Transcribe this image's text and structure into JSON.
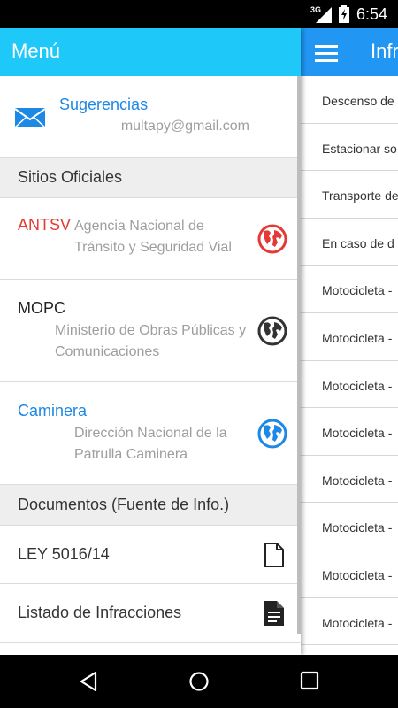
{
  "status_bar": {
    "network": "3G",
    "time": "6:54"
  },
  "background_screen": {
    "title": "Infr",
    "rows": [
      "Descenso de",
      "Estacionar so",
      "Transporte de",
      "En caso de d",
      "Motocicleta -",
      "Motocicleta -",
      "Motocicleta -",
      "Motocicleta -",
      "Motocicleta -",
      "Motocicleta -",
      "Motocicleta -",
      "Motocicleta -"
    ]
  },
  "drawer": {
    "title": "Menú",
    "suggestions": {
      "label": "Sugerencias",
      "email": "multapy@gmail.com",
      "icon": "mail-icon"
    },
    "sites_header": "Sitios Oficiales",
    "sites": [
      {
        "name": "ANTSV",
        "desc": "Agencia Nacional de Tránsito y Seguridad Vial",
        "color": "#e53935",
        "icon_color": "#e53935"
      },
      {
        "name": "MOPC",
        "desc": "Ministerio de Obras Públicas y Comunicaciones",
        "color": "#222222",
        "icon_color": "#333333"
      },
      {
        "name": "Caminera",
        "desc": "Dirección Nacional de la Patrulla Caminera",
        "color": "#1e88e5",
        "icon_color": "#1e88e5"
      }
    ],
    "documents_header": "Documentos (Fuente de Info.)",
    "documents": [
      {
        "label": "LEY 5016/14",
        "icon": "file-outline-icon"
      },
      {
        "label": "Listado de Infracciones",
        "icon": "file-text-icon"
      }
    ]
  },
  "colors": {
    "drawer_header": "#1ec8f8",
    "app_toolbar": "#2196f3",
    "link_blue": "#1e88e5",
    "antsv_red": "#e53935"
  }
}
